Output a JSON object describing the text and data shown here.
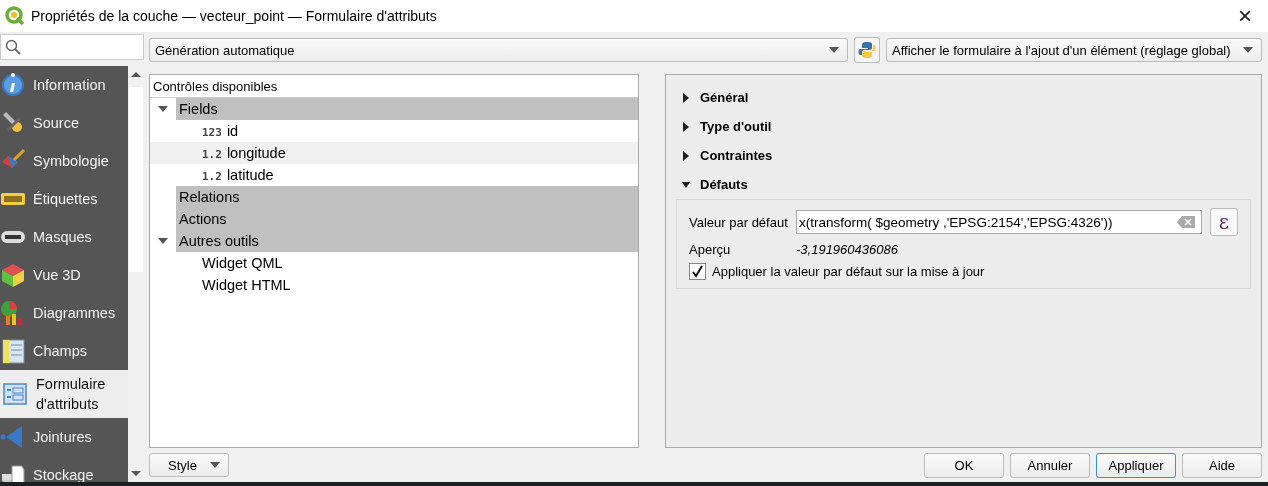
{
  "window": {
    "title": "Propriétés de la couche — vecteur_point — Formulaire d'attributs",
    "close": "×"
  },
  "sidebar": {
    "items": [
      {
        "label": "Information",
        "selected": false
      },
      {
        "label": "Source",
        "selected": false
      },
      {
        "label": "Symbologie",
        "selected": false
      },
      {
        "label": "Étiquettes",
        "selected": false
      },
      {
        "label": "Masques",
        "selected": false
      },
      {
        "label": "Vue 3D",
        "selected": false
      },
      {
        "label": "Diagrammes",
        "selected": false
      },
      {
        "label": "Champs",
        "selected": false
      },
      {
        "label": "Formulaire d'attributs",
        "selected": true
      },
      {
        "label": "Jointures",
        "selected": false
      },
      {
        "label": "Stockage",
        "selected": false
      }
    ]
  },
  "toolbar": {
    "layout_mode": "Génération automatique",
    "form_behaviour": "Afficher le formulaire à l'ajout d'un élément (réglage global)"
  },
  "tree": {
    "header": "Contrôles disponibles",
    "items": [
      {
        "kind": "group",
        "label": "Fields",
        "expanded": true,
        "children": [
          {
            "kind": "field",
            "type": "123",
            "label": "id"
          },
          {
            "kind": "field",
            "type": "1.2",
            "label": "longitude"
          },
          {
            "kind": "field",
            "type": "1.2",
            "label": "latitude"
          }
        ]
      },
      {
        "kind": "group",
        "label": "Relations"
      },
      {
        "kind": "group",
        "label": "Actions"
      },
      {
        "kind": "group",
        "label": "Autres outils",
        "expanded": true,
        "children": [
          {
            "kind": "widget",
            "label": "Widget QML"
          },
          {
            "kind": "widget",
            "label": "Widget HTML"
          }
        ]
      }
    ]
  },
  "sections": [
    {
      "title": "Général",
      "expanded": false
    },
    {
      "title": "Type d'outil",
      "expanded": false
    },
    {
      "title": "Contraintes",
      "expanded": false
    },
    {
      "title": "Défauts",
      "expanded": true
    }
  ],
  "defaults": {
    "value_label": "Valeur par défaut",
    "value": "x(transform( $geometry ,'EPSG:2154','EPSG:4326'))",
    "expression_button": "ε",
    "preview_label": "Aperçu",
    "preview": "-3,191960436086",
    "apply_on_update": {
      "label": "Appliquer la valeur par défaut sur la mise à jour",
      "checked": true
    }
  },
  "style_button": "Style",
  "buttons": [
    {
      "label": "OK",
      "selected": false
    },
    {
      "label": "Annuler",
      "selected": false
    },
    {
      "label": "Appliquer",
      "selected": true
    },
    {
      "label": "Aide",
      "selected": false
    }
  ]
}
